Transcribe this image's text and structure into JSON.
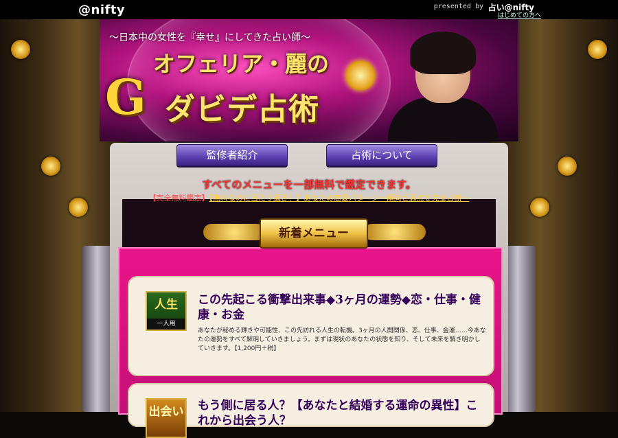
{
  "topbar": {
    "logo": "@nifty",
    "presented": "presented by",
    "brand": "占い@nifty",
    "first_time_link": "はじめての方へ"
  },
  "hero": {
    "catchphrase": "〜日本中の女性を『幸せ』にしてきた占い師〜",
    "name": "オフェリア・麗の",
    "g_mark": "G",
    "subtitle": "ダビデ占術"
  },
  "nav": {
    "items": [
      {
        "label": "監修者紹介"
      },
      {
        "label": "占術について"
      }
    ]
  },
  "headline": "すべてのメニューを一部無料で鑑定できます。",
  "promo": {
    "tag": "【完全無料鑑定】",
    "text": "【無料なのに当たり過ぎ！】あなたの恋愛パターン〜傾向と弱点を完全占断〜"
  },
  "section_title": "新着メニュー",
  "menus": [
    {
      "badge": "人生",
      "badge_sub": "一人用",
      "title": "この先起こる衝撃出来事◆3ヶ月の運勢◆恋・仕事・健康・お金",
      "description": "あなたが秘める輝きや可能性、この先訪れる人生の転機。3ヶ月の人間関係、恋、仕事、金運……今あなたの運勢をすべて解明していきましょう。まずは現状のあなたの状態を知り、そして未来を解き明かしていきます。【1,200円＋税】"
    },
    {
      "badge": "出会い",
      "title": "もう側に居る人？【あなたと結婚する運命の異性】これから出会う人？"
    }
  ],
  "colors": {
    "accent_magenta": "#e9158a",
    "gold": "#f0c246",
    "nav_purple": "#5a3fb0",
    "headline_red": "#ff3333"
  }
}
